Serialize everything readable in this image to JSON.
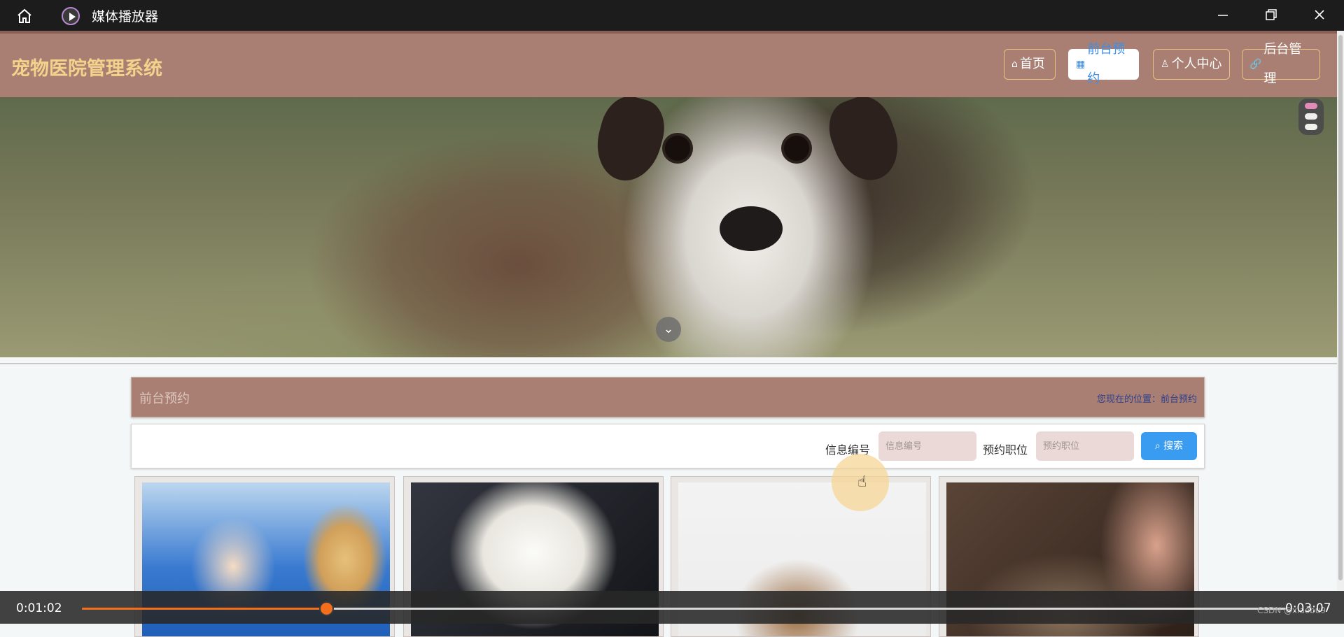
{
  "player": {
    "title": "媒体播放器",
    "time_current": "0:01:02",
    "time_total": "0:03:07",
    "progress_fraction": 0.2031,
    "watermark": "CSDN @xiaobu9"
  },
  "site": {
    "brand": "宠物医院管理系统",
    "nav": [
      {
        "label": "首页",
        "icon": "home-icon"
      },
      {
        "label": "前台预约",
        "icon": "grid-icon"
      },
      {
        "label": "个人中心",
        "icon": "user-icon"
      },
      {
        "label": "后台管理",
        "icon": "link-icon"
      }
    ],
    "active_nav": "前台预约"
  },
  "page": {
    "section_title": "前台预约",
    "location_label": "您现在的位置：",
    "location_value": "前台预约"
  },
  "search": {
    "field1_label": "信息编号",
    "field1_placeholder": "信息编号",
    "field2_label": "预约职位",
    "field2_placeholder": "预约职位",
    "button_label": "搜索"
  },
  "colors": {
    "header_bg": "#a97f74",
    "brand_text": "#f2d38c",
    "accent_blue": "#3a9cf0",
    "progress": "#f36f1c"
  }
}
